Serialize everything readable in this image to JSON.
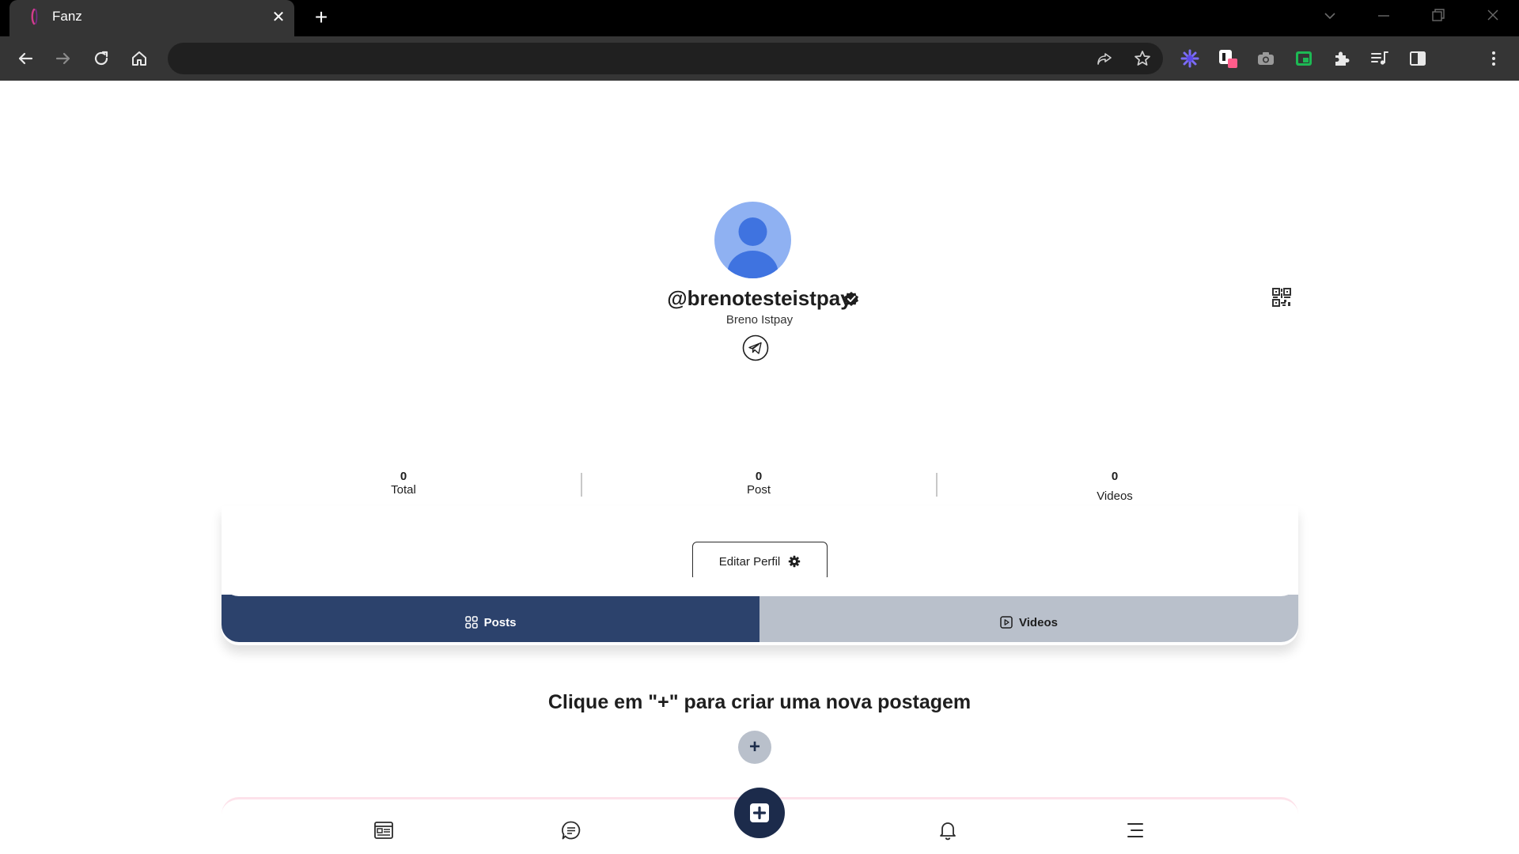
{
  "browser": {
    "tab_title": "Fanz",
    "tab_close_glyph": "✕",
    "new_tab_glyph": "+",
    "icons": [
      "back-icon",
      "forward-icon",
      "reload-icon",
      "home-icon",
      "share-icon",
      "bookmark-star-icon",
      "extension-icons",
      "extensions-puzzle-icon",
      "media-icon",
      "side-panel-icon",
      "menu-dots-icon"
    ]
  },
  "profile": {
    "username": "@brenotesteistpay",
    "display_name": "Breno Istpay",
    "stats": [
      {
        "value": "0",
        "label": "Total"
      },
      {
        "value": "0",
        "label": "Post"
      },
      {
        "value": "0",
        "label": "Videos"
      }
    ],
    "edit_button_label": "Editar Perfil"
  },
  "content_tabs": {
    "posts_label": "Posts",
    "videos_label": "Videos",
    "active": "Posts"
  },
  "empty_state": {
    "message": "Clique em \"+\" para criar uma nova postagem",
    "plus_glyph": "+"
  },
  "colors": {
    "primary": "#2c426c",
    "fab": "#1c2b4b",
    "inactive_tab": "#b9c0cb",
    "avatar_bg": "#8fb1f2",
    "avatar_fg": "#3f73e0"
  }
}
